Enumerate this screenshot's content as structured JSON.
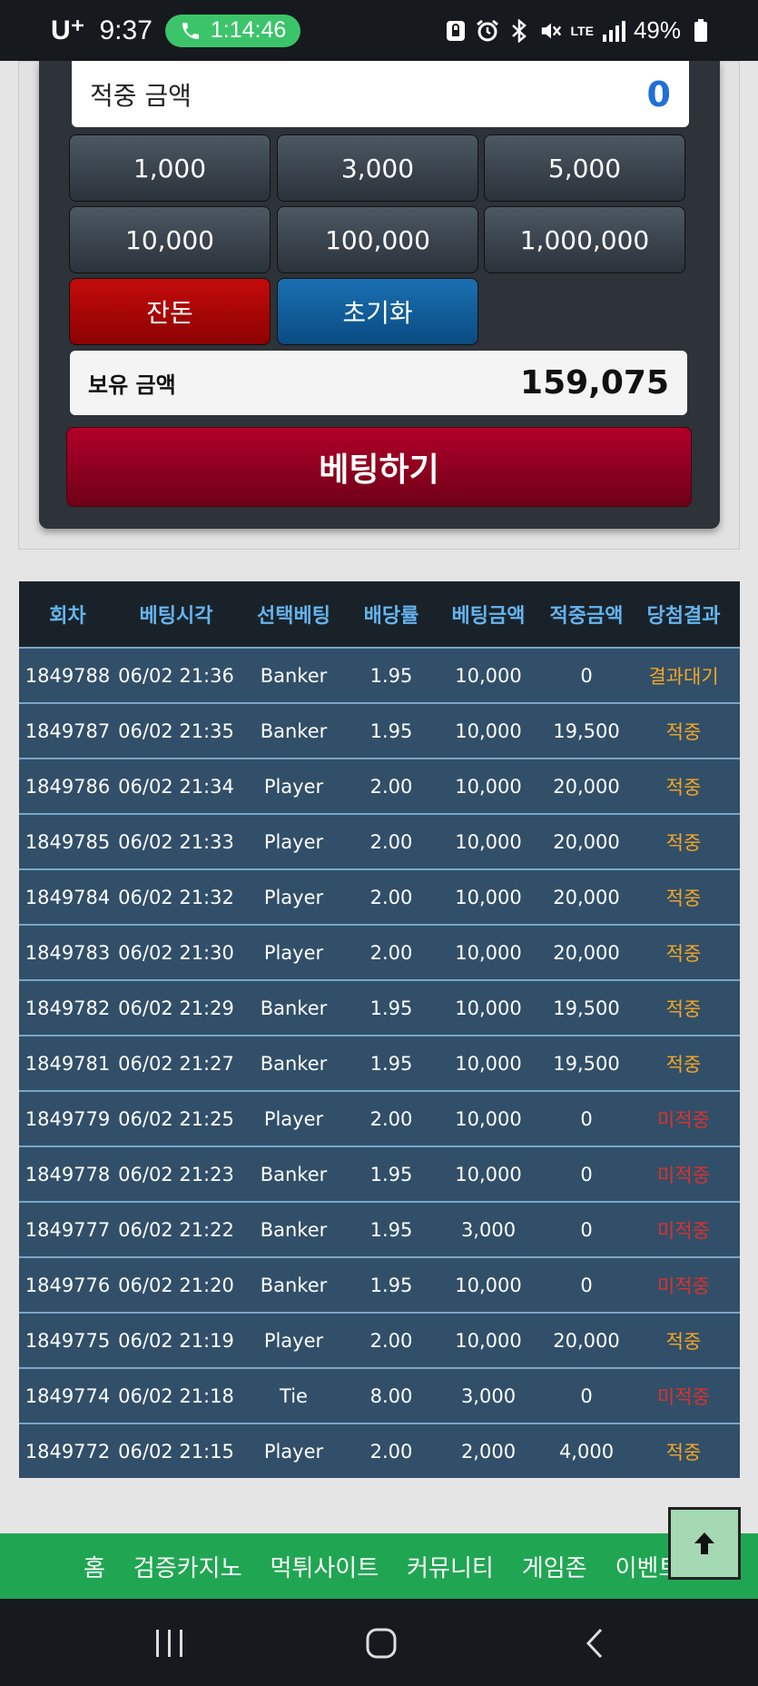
{
  "status_bar": {
    "carrier": "U⁺",
    "time": "9:37",
    "call_timer": "1:14:46",
    "network": "LTE",
    "battery": "49%"
  },
  "bet_panel": {
    "win_label": "적중 금액",
    "win_value": "0",
    "amount_buttons": [
      "1,000",
      "3,000",
      "5,000",
      "10,000",
      "100,000",
      "1,000,000"
    ],
    "all_in_label": "잔돈",
    "reset_label": "초기화",
    "balance_label": "보유 금액",
    "balance_value": "159,075",
    "bet_label": "베팅하기"
  },
  "history": {
    "headers": [
      "회차",
      "베팅시각",
      "선택베팅",
      "배당률",
      "베팅금액",
      "적중금액",
      "당첨결과"
    ],
    "rows": [
      [
        "1849788",
        "06/02 21:36",
        "Banker",
        "1.95",
        "10,000",
        "0",
        "결과대기"
      ],
      [
        "1849787",
        "06/02 21:35",
        "Banker",
        "1.95",
        "10,000",
        "19,500",
        "적중"
      ],
      [
        "1849786",
        "06/02 21:34",
        "Player",
        "2.00",
        "10,000",
        "20,000",
        "적중"
      ],
      [
        "1849785",
        "06/02 21:33",
        "Player",
        "2.00",
        "10,000",
        "20,000",
        "적중"
      ],
      [
        "1849784",
        "06/02 21:32",
        "Player",
        "2.00",
        "10,000",
        "20,000",
        "적중"
      ],
      [
        "1849783",
        "06/02 21:30",
        "Player",
        "2.00",
        "10,000",
        "20,000",
        "적중"
      ],
      [
        "1849782",
        "06/02 21:29",
        "Banker",
        "1.95",
        "10,000",
        "19,500",
        "적중"
      ],
      [
        "1849781",
        "06/02 21:27",
        "Banker",
        "1.95",
        "10,000",
        "19,500",
        "적중"
      ],
      [
        "1849779",
        "06/02 21:25",
        "Player",
        "2.00",
        "10,000",
        "0",
        "미적중"
      ],
      [
        "1849778",
        "06/02 21:23",
        "Banker",
        "1.95",
        "10,000",
        "0",
        "미적중"
      ],
      [
        "1849777",
        "06/02 21:22",
        "Banker",
        "1.95",
        "3,000",
        "0",
        "미적중"
      ],
      [
        "1849776",
        "06/02 21:20",
        "Banker",
        "1.95",
        "10,000",
        "0",
        "미적중"
      ],
      [
        "1849775",
        "06/02 21:19",
        "Player",
        "2.00",
        "10,000",
        "20,000",
        "적중"
      ],
      [
        "1849774",
        "06/02 21:18",
        "Tie",
        "8.00",
        "3,000",
        "0",
        "미적중"
      ],
      [
        "1849772",
        "06/02 21:15",
        "Player",
        "2.00",
        "2,000",
        "4,000",
        "적중"
      ]
    ]
  },
  "footer_nav": {
    "items": [
      "홈",
      "검증카지노",
      "먹튀사이트",
      "커뮤니티",
      "게임존",
      "이벤트"
    ]
  },
  "colors": {
    "win": "#f5a623",
    "lose": "#e0302a",
    "header_text": "#64b4ee",
    "nav_bg": "#20a652"
  }
}
